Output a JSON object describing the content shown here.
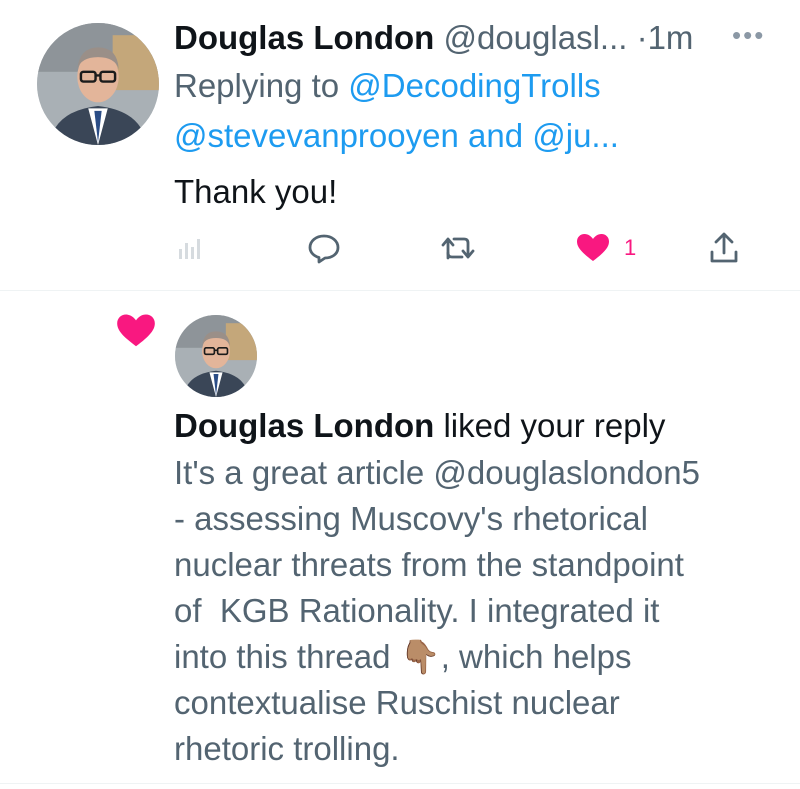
{
  "tweet": {
    "author_name": "Douglas London",
    "author_handle": "@douglasl...",
    "separator": "·",
    "time": "1m",
    "more_icon": "more-horizontal-icon",
    "replying_prefix": "Replying to",
    "replying_to_1": "@DecodingTrolls",
    "replying_to_2": "@stevevanprooyen",
    "replying_and": "and",
    "replying_to_3": "@ju...",
    "text": "Thank you!",
    "actions": {
      "analytics_icon": "analytics-icon",
      "reply_icon": "reply-icon",
      "retweet_icon": "retweet-icon",
      "like_icon": "heart-icon",
      "like_count": "1",
      "share_icon": "share-icon"
    },
    "like_color": "#f91880",
    "mention_color": "#1d9bf0"
  },
  "notification": {
    "icon": "heart-icon",
    "actor_name": "Douglas London",
    "action_text": "liked your reply",
    "body_lines": [
      "It's a great article @douglaslondon5",
      "- assessing Muscovy's rhetorical",
      "nuclear threats from the standpoint",
      "of  KGB Rationality. I integrated it",
      "into this thread 👇🏽, which helps",
      "contextualise Ruschist nuclear",
      "rhetoric trolling."
    ]
  }
}
